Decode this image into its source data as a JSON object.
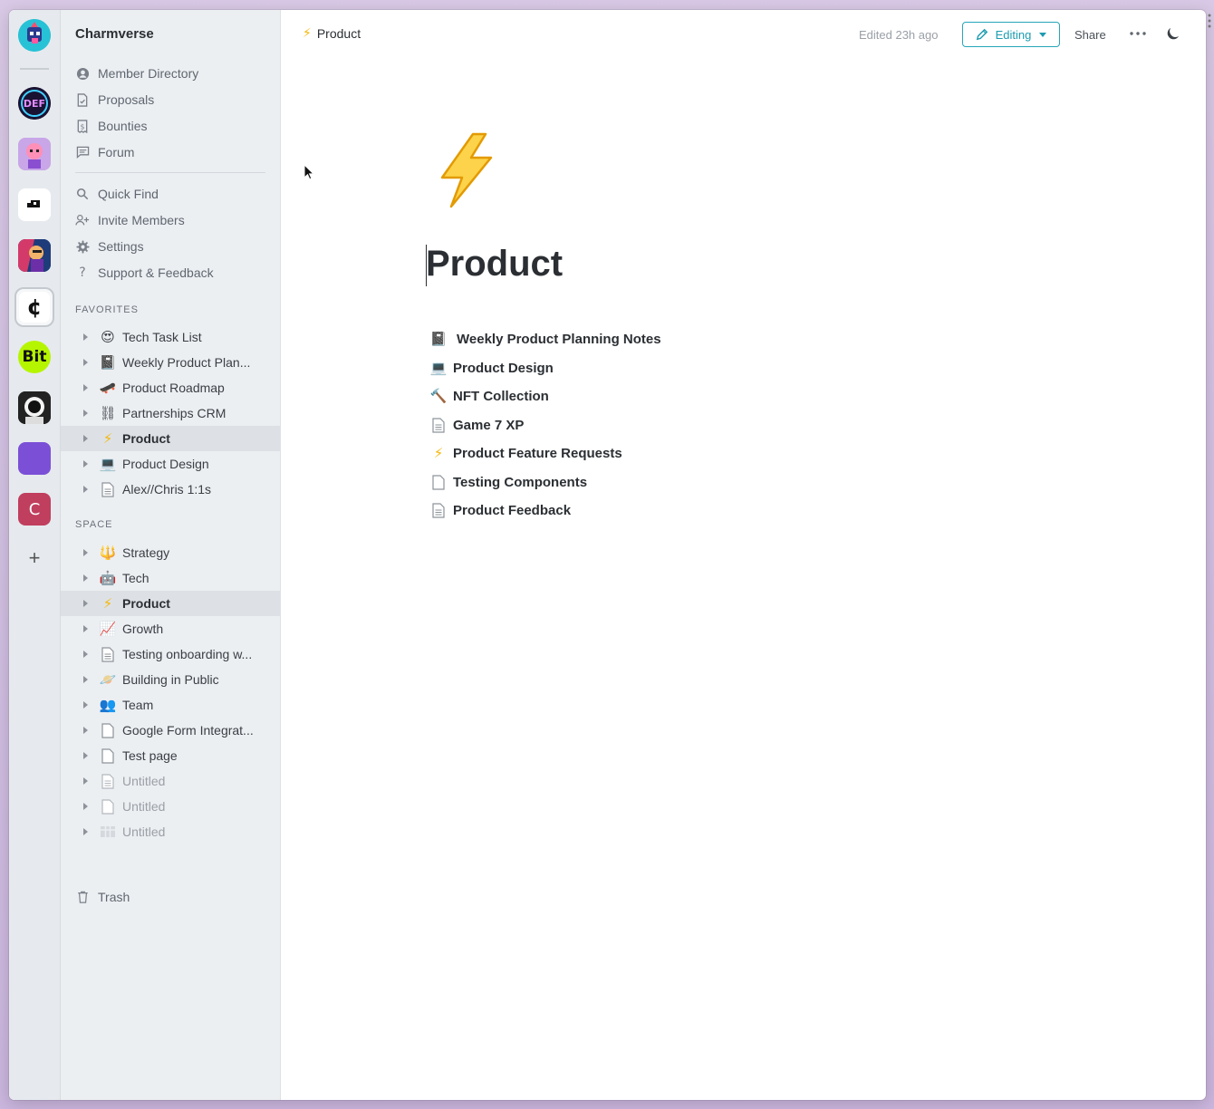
{
  "space_rail": {
    "spaces": [
      {
        "name": "current-space",
        "letter": ""
      },
      {
        "name": "def-space",
        "letter": "DEF"
      },
      {
        "name": "pink-space",
        "letter": ""
      },
      {
        "name": "black-white-space",
        "letter": ""
      },
      {
        "name": "art-space",
        "letter": ""
      },
      {
        "name": "charmverse-space",
        "letter": "¢"
      },
      {
        "name": "bit-space",
        "letter": "Bit"
      },
      {
        "name": "astronaut-space",
        "letter": ""
      },
      {
        "name": "purple-space",
        "letter": ""
      },
      {
        "name": "c-space",
        "letter": "C"
      }
    ],
    "add_label": "+"
  },
  "sidebar": {
    "workspace_name": "Charmverse",
    "nav": [
      {
        "label": "Member Directory",
        "icon": "person-icon"
      },
      {
        "label": "Proposals",
        "icon": "document-check-icon"
      },
      {
        "label": "Bounties",
        "icon": "receipt-icon"
      },
      {
        "label": "Forum",
        "icon": "chat-icon"
      }
    ],
    "nav2": [
      {
        "label": "Quick Find",
        "icon": "search-icon"
      },
      {
        "label": "Invite Members",
        "icon": "add-people-icon"
      },
      {
        "label": "Settings",
        "icon": "gear-icon"
      },
      {
        "label": "Support & Feedback",
        "icon": "question-icon"
      }
    ],
    "favorites_label": "FAVORITES",
    "favorites": [
      {
        "label": "Tech Task List",
        "emoji": "😍"
      },
      {
        "label": "Weekly Product Plan...",
        "emoji": "📓"
      },
      {
        "label": "Product Roadmap",
        "emoji": "🛹"
      },
      {
        "label": "Partnerships CRM",
        "emoji": "⛓"
      },
      {
        "label": "Product",
        "emoji": "⚡"
      },
      {
        "label": "Product Design",
        "emoji": "💻"
      },
      {
        "label": "Alex//Chris 1:1s",
        "emoji": "📄"
      }
    ],
    "space_label": "SPACE",
    "space": [
      {
        "label": "Strategy",
        "emoji": "🔱"
      },
      {
        "label": "Tech",
        "emoji": "🤖"
      },
      {
        "label": "Product",
        "emoji": "⚡"
      },
      {
        "label": "Growth",
        "emoji": "📈"
      },
      {
        "label": "Testing onboarding w...",
        "emoji": "📄"
      },
      {
        "label": "Building in Public",
        "emoji": "🪐"
      },
      {
        "label": "Team",
        "emoji": "👥"
      },
      {
        "label": "Google Form Integrat...",
        "emoji": "📃"
      },
      {
        "label": "Test page",
        "emoji": "📃"
      },
      {
        "label": "Untitled",
        "emoji": "📄"
      },
      {
        "label": "Untitled",
        "emoji": "📃"
      },
      {
        "label": "Untitled",
        "emoji": "▦"
      }
    ],
    "trash_label": "Trash"
  },
  "header": {
    "breadcrumb_icon": "⚡",
    "breadcrumb": "Product",
    "edited": "Edited 23h ago",
    "editing_label": "Editing",
    "share_label": "Share"
  },
  "page": {
    "title": "Product",
    "subpages": [
      {
        "label": "Weekly Product Planning Notes",
        "emoji": "📓"
      },
      {
        "label": "Product Design",
        "emoji": "💻"
      },
      {
        "label": "NFT Collection",
        "emoji": "🔨"
      },
      {
        "label": "Game 7 XP",
        "emoji": "📄"
      },
      {
        "label": "Product Feature Requests",
        "emoji": "⚡"
      },
      {
        "label": "Testing Components",
        "emoji": "📃"
      },
      {
        "label": "Product Feedback",
        "emoji": "📄"
      }
    ]
  },
  "colors": {
    "accent": "#1c9cb0",
    "sidebar_bg": "#eceff2",
    "active_row": "#dde1e5",
    "bolt": "#f5b70a"
  }
}
